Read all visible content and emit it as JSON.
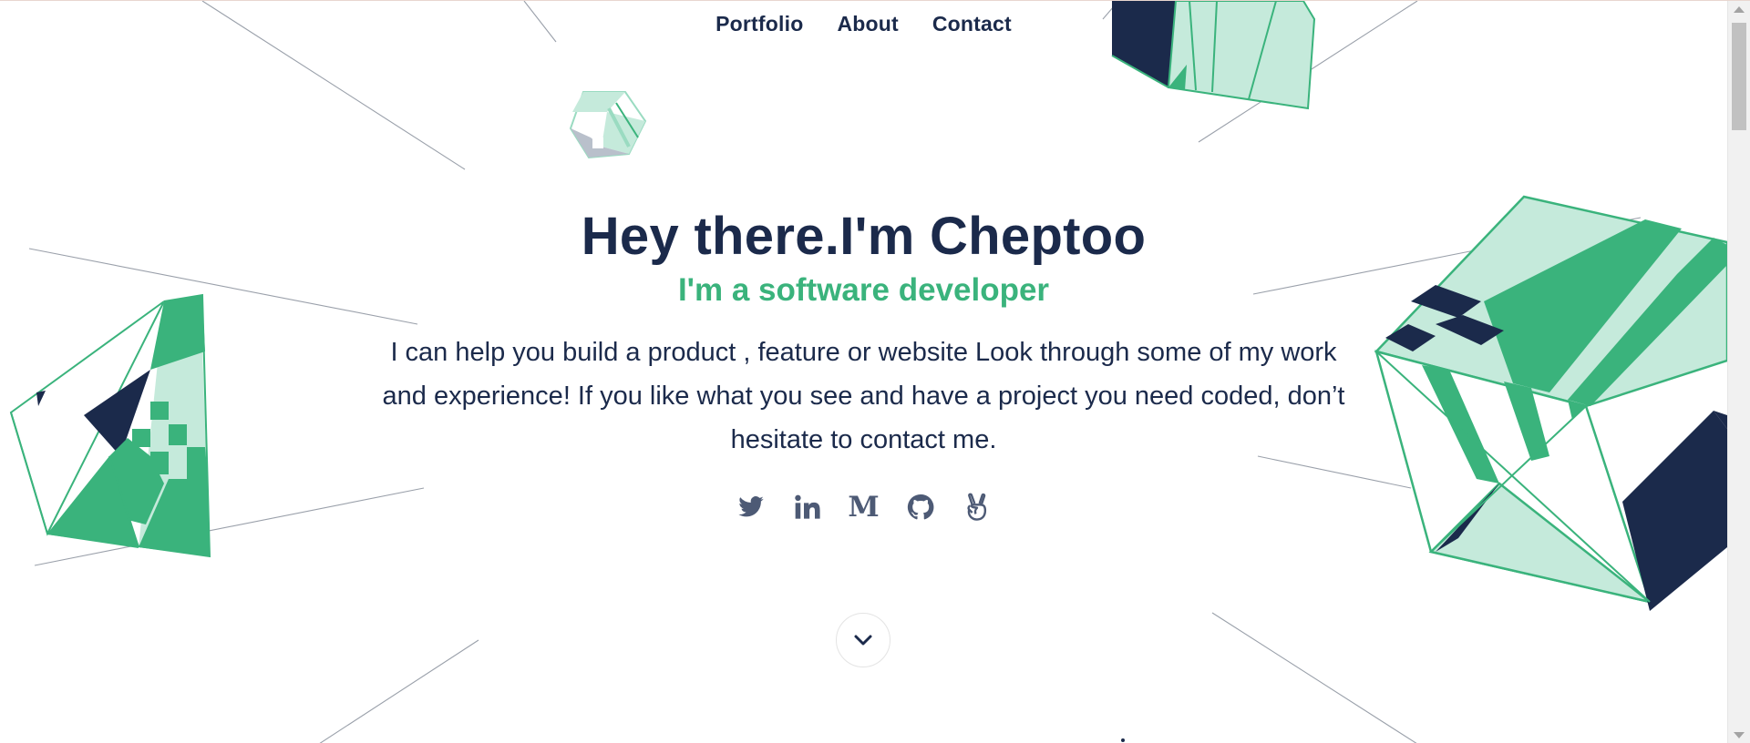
{
  "nav": {
    "items": [
      "Portfolio",
      "About",
      "Contact"
    ]
  },
  "hero": {
    "title": "Hey there.I'm Cheptoo",
    "subtitle": "I'm a software developer",
    "description": "I can help you build a product , feature or website Look through some of my work and experience! If you like what you see and have a project you need coded, don’t hesitate to contact me."
  },
  "socials": [
    {
      "name": "twitter-icon"
    },
    {
      "name": "linkedin-icon",
      "glyph": "in"
    },
    {
      "name": "medium-icon",
      "glyph": "M"
    },
    {
      "name": "github-icon"
    },
    {
      "name": "angellist-icon"
    }
  ],
  "colors": {
    "navy": "#1b2a4b",
    "green": "#3ab37c",
    "mint": "#c5eadb",
    "icon": "#4d5a75"
  }
}
